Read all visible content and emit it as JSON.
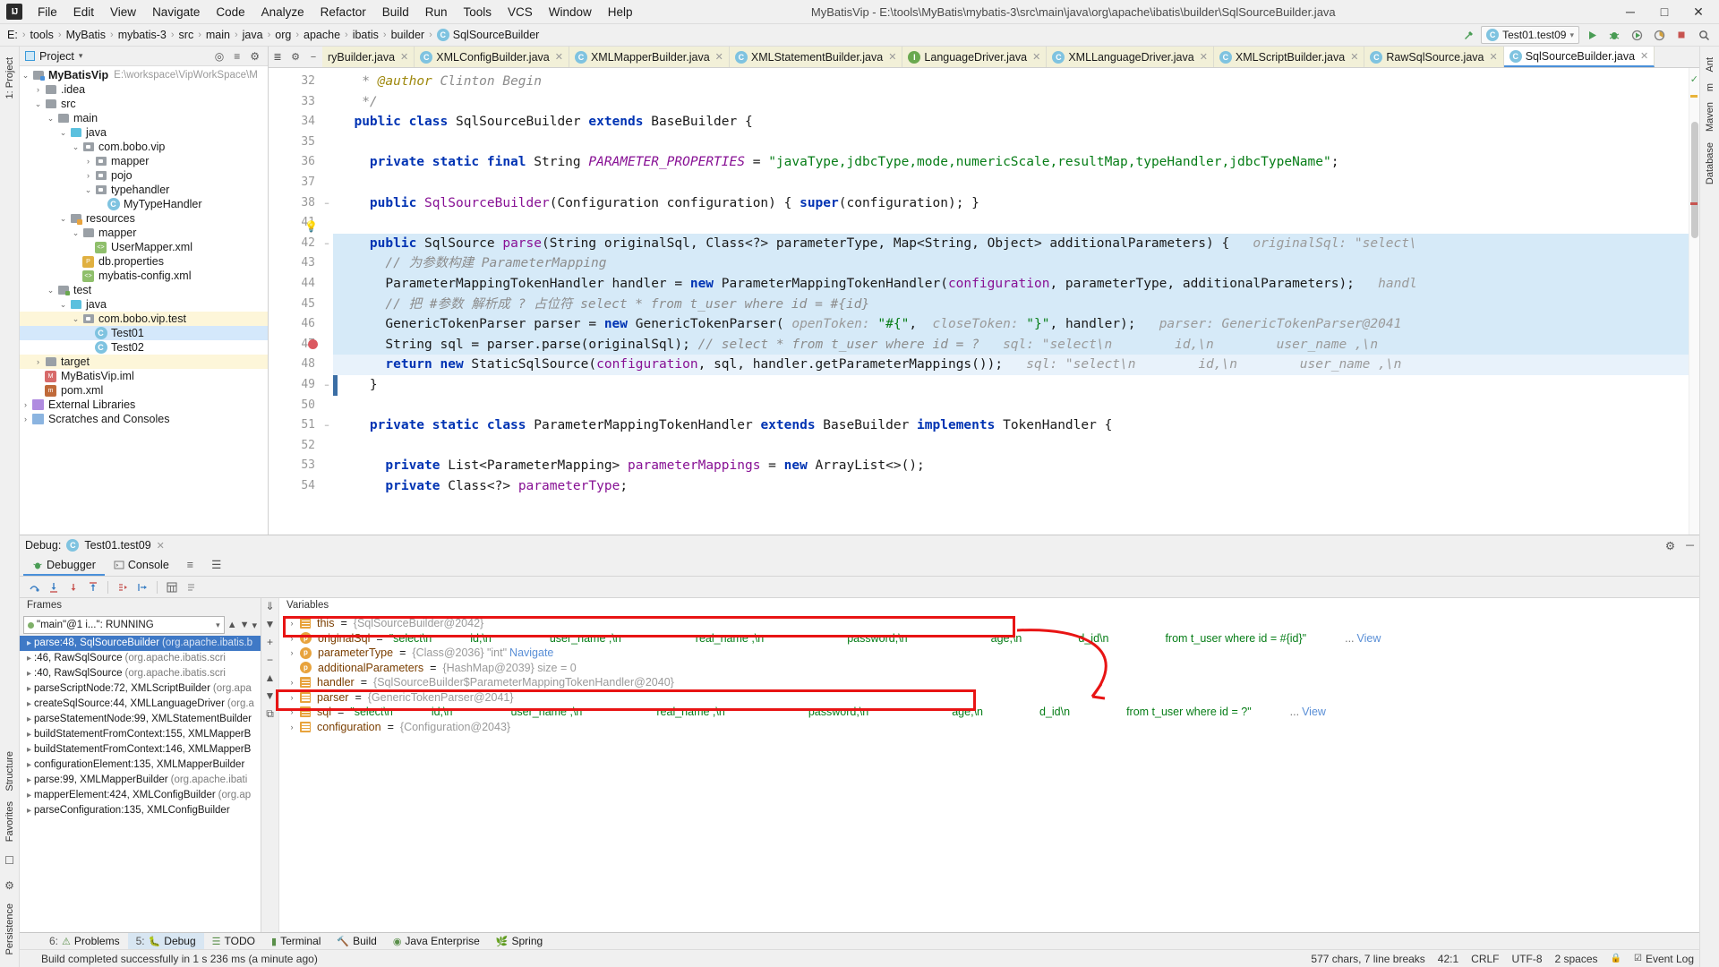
{
  "titlebar": {
    "logo": "IJ",
    "window_title": "MyBatisVip - E:\\tools\\MyBatis\\mybatis-3\\src\\main\\java\\org\\apache\\ibatis\\builder\\SqlSourceBuilder.java",
    "menus": [
      "File",
      "Edit",
      "View",
      "Navigate",
      "Code",
      "Analyze",
      "Refactor",
      "Build",
      "Run",
      "Tools",
      "VCS",
      "Window",
      "Help"
    ],
    "minimize": "─",
    "maximize": "□",
    "close": "✕"
  },
  "navbar": {
    "crumbs": [
      "E:",
      "tools",
      "MyBatis",
      "mybatis-3",
      "src",
      "main",
      "java",
      "org",
      "apache",
      "ibatis",
      "builder"
    ],
    "class_crumb": "SqlSourceBuilder",
    "class_icon": "C",
    "run_config": "Test01.test09",
    "run_config_icon": "C",
    "build_icon": "hammer-icon",
    "run_icon": "▶",
    "debug_icon": "debug-bug-icon",
    "coverage_icon": "◑",
    "profile_icon": "◷",
    "stop_icon": "■",
    "search_icon": "⌕"
  },
  "left_rail": {
    "top_tab": "1: Project",
    "bottom_tabs": [
      "Structure",
      "Favorites",
      "Persistence"
    ]
  },
  "right_rail": {
    "tabs": [
      "Ant",
      "m",
      "Maven",
      "Database"
    ]
  },
  "project": {
    "title": "Project",
    "chevron": "▾",
    "icons": [
      "locate-icon",
      "collapse-all-icon",
      "settings-gear-icon"
    ],
    "tree": [
      {
        "depth": 0,
        "arrow": "⌄",
        "icon": "folder-module",
        "label": "MyBatisVip",
        "bold": true,
        "path": "E:\\workspace\\VipWorkSpace\\M"
      },
      {
        "depth": 1,
        "arrow": "›",
        "icon": "folder",
        "label": ".idea",
        "bold": false,
        "path": ""
      },
      {
        "depth": 1,
        "arrow": "⌄",
        "icon": "folder",
        "label": "src",
        "bold": false,
        "path": ""
      },
      {
        "depth": 2,
        "arrow": "⌄",
        "icon": "folder",
        "label": "main",
        "bold": false,
        "path": ""
      },
      {
        "depth": 3,
        "arrow": "⌄",
        "icon": "folder-source",
        "label": "java",
        "bold": false,
        "path": ""
      },
      {
        "depth": 4,
        "arrow": "⌄",
        "icon": "package",
        "label": "com.bobo.vip",
        "bold": false,
        "path": ""
      },
      {
        "depth": 5,
        "arrow": "›",
        "icon": "package",
        "label": "mapper",
        "bold": false,
        "path": ""
      },
      {
        "depth": 5,
        "arrow": "›",
        "icon": "package",
        "label": "pojo",
        "bold": false,
        "path": ""
      },
      {
        "depth": 5,
        "arrow": "⌄",
        "icon": "package",
        "label": "typehandler",
        "bold": false,
        "path": ""
      },
      {
        "depth": 6,
        "arrow": "",
        "icon": "class",
        "label": "MyTypeHandler",
        "bold": false,
        "path": ""
      },
      {
        "depth": 3,
        "arrow": "⌄",
        "icon": "folder-resources",
        "label": "resources",
        "bold": false,
        "path": ""
      },
      {
        "depth": 4,
        "arrow": "⌄",
        "icon": "folder",
        "label": "mapper",
        "bold": false,
        "path": ""
      },
      {
        "depth": 5,
        "arrow": "",
        "icon": "xml",
        "label": "UserMapper.xml",
        "bold": false,
        "path": ""
      },
      {
        "depth": 4,
        "arrow": "",
        "icon": "properties",
        "label": "db.properties",
        "bold": false,
        "path": ""
      },
      {
        "depth": 4,
        "arrow": "",
        "icon": "xml",
        "label": "mybatis-config.xml",
        "bold": false,
        "path": ""
      },
      {
        "depth": 2,
        "arrow": "⌄",
        "icon": "folder-test",
        "label": "test",
        "bold": false,
        "path": ""
      },
      {
        "depth": 3,
        "arrow": "⌄",
        "icon": "folder-source",
        "label": "java",
        "bold": false,
        "path": ""
      },
      {
        "depth": 4,
        "arrow": "⌄",
        "icon": "package",
        "label": "com.bobo.vip.test",
        "bold": false,
        "path": "",
        "highlight": "a"
      },
      {
        "depth": 5,
        "arrow": "",
        "icon": "class",
        "label": "Test01",
        "bold": false,
        "path": "",
        "highlight": "b"
      },
      {
        "depth": 5,
        "arrow": "",
        "icon": "class",
        "label": "Test02",
        "bold": false,
        "path": ""
      },
      {
        "depth": 1,
        "arrow": "›",
        "icon": "folder-target",
        "label": "target",
        "bold": false,
        "path": "",
        "highlight": "a"
      },
      {
        "depth": 1,
        "arrow": "",
        "icon": "iml",
        "label": "MyBatisVip.iml",
        "bold": false,
        "path": ""
      },
      {
        "depth": 1,
        "arrow": "",
        "icon": "maven",
        "label": "pom.xml",
        "bold": false,
        "path": ""
      },
      {
        "depth": 0,
        "arrow": "›",
        "icon": "library",
        "label": "External Libraries",
        "bold": false,
        "path": ""
      },
      {
        "depth": 0,
        "arrow": "›",
        "icon": "scratch",
        "label": "Scratches and Consoles",
        "bold": false,
        "path": ""
      }
    ]
  },
  "editor": {
    "tabs": [
      {
        "label": "ryBuilder.java",
        "icon": "C",
        "active": false,
        "clipped": true
      },
      {
        "label": "XMLConfigBuilder.java",
        "icon": "C",
        "active": false
      },
      {
        "label": "XMLMapperBuilder.java",
        "icon": "C",
        "active": false
      },
      {
        "label": "XMLStatementBuilder.java",
        "icon": "C",
        "active": false
      },
      {
        "label": "LanguageDriver.java",
        "icon": "I",
        "active": false
      },
      {
        "label": "XMLLanguageDriver.java",
        "icon": "C",
        "active": false
      },
      {
        "label": "XMLScriptBuilder.java",
        "icon": "C",
        "active": false
      },
      {
        "label": "RawSqlSource.java",
        "icon": "C",
        "active": false
      },
      {
        "label": "SqlSourceBuilder.java",
        "icon": "C",
        "active": true
      }
    ],
    "tab_close": "✕",
    "first_line": 32,
    "lines": [
      {
        "n": 32,
        "fold": "",
        "html": "   <span class='cmt'>* <span class='anno'>@author</span> Clinton Begin</span>"
      },
      {
        "n": 33,
        "fold": "",
        "html": "   <span class='cmt'>*/</span>"
      },
      {
        "n": 34,
        "fold": "",
        "html": "  <span class='kw'>public class</span> SqlSourceBuilder <span class='kw'>extends</span> BaseBuilder {"
      },
      {
        "n": 35,
        "fold": "",
        "html": ""
      },
      {
        "n": 36,
        "fold": "",
        "html": "    <span class='kw'>private static final</span> String <span class='stat'>PARAMETER_PROPERTIES</span> = <span class='str'>\"javaType,jdbcType,mode,numericScale,resultMap,typeHandler,jdbcTypeName\"</span>;"
      },
      {
        "n": 37,
        "fold": "",
        "html": ""
      },
      {
        "n": 38,
        "fold": "−",
        "html": "    <span class='kw'>public</span> <span class='fld'>SqlSourceBuilder</span>(Configuration configuration) { <span class='kw'>super</span>(configuration); }"
      },
      {
        "n": 41,
        "fold": "",
        "html": ""
      },
      {
        "n": 42,
        "fold": "−",
        "html": "    <span class='kw'>public</span> SqlSource <span class='fld'>parse</span>(String originalSql, Class&lt;?&gt; parameterType, Map&lt;String, Object&gt; additionalParameters) {",
        "hint": "originalSql: \"select\\",
        "hl": true
      },
      {
        "n": 43,
        "fold": "",
        "html": "      <span class='cmt-cn'>// 为参数构建 ParameterMapping</span>",
        "hl": true
      },
      {
        "n": 44,
        "fold": "",
        "html": "      ParameterMappingTokenHandler handler = <span class='kw'>new</span> ParameterMappingTokenHandler(<span class='fld'>configuration</span>, parameterType, additionalParameters);",
        "hint": "handl",
        "hl": true
      },
      {
        "n": 45,
        "fold": "",
        "html": "      <span class='cmt-cn'>// 把 #参数 解析成 ? 占位符 select * from t_user where id = #{id}</span>",
        "hl": true
      },
      {
        "n": 46,
        "fold": "",
        "html": "      GenericTokenParser parser = <span class='kw'>new</span> GenericTokenParser( <span class='hint'>openToken:</span> <span class='str'>\"#{\"</span>,  <span class='hint'>closeToken:</span> <span class='str'>\"}\"</span>, handler);",
        "hint": "parser: GenericTokenParser@2041",
        "hl": true
      },
      {
        "n": 47,
        "fold": "",
        "html": "      String sql = parser.parse(originalSql); <span class='cmt'>// select * from t_user where id = ?</span>",
        "hint": "sql: \"select\\n        id,\\n        user_name ,\\n",
        "hl": true,
        "breakpoint": true
      },
      {
        "n": 48,
        "fold": "",
        "html": "      <span class='kw'>return new</span> StaticSqlSource(<span class='fld'>configuration</span>, sql, handler.getParameterMappings());",
        "hint": "sql: \"select\\n        id,\\n        user_name ,\\n",
        "hl": true,
        "current": true
      },
      {
        "n": 49,
        "fold": "−",
        "html": "    }"
      },
      {
        "n": 50,
        "fold": "",
        "html": ""
      },
      {
        "n": 51,
        "fold": "−",
        "html": "    <span class='kw'>private static class</span> ParameterMappingTokenHandler <span class='kw'>extends</span> BaseBuilder <span class='kw'>implements</span> TokenHandler {"
      },
      {
        "n": 52,
        "fold": "",
        "html": ""
      },
      {
        "n": 53,
        "fold": "",
        "html": "      <span class='kw'>private</span> List&lt;ParameterMapping&gt; <span class='fld'>parameterMappings</span> = <span class='kw'>new</span> ArrayList&lt;&gt;();"
      },
      {
        "n": 54,
        "fold": "",
        "html": "      <span class='kw'>private</span> Class&lt;?&gt; <span class='fld'>parameterType</span>;"
      }
    ]
  },
  "debug": {
    "label": "Debug:",
    "session": "Test01.test09",
    "session_icon": "C",
    "close": "✕",
    "settings_icon": "⚙",
    "minimize_icon": "─",
    "tabs": [
      {
        "label": "Debugger",
        "icon": "debugger-icon",
        "active": true
      },
      {
        "label": "Console",
        "icon": "console-icon",
        "active": false
      }
    ],
    "tab_icons": [
      "≡",
      "☰"
    ],
    "toolbar_icons": [
      "step-over-icon",
      "step-into-icon",
      "force-step-into-icon",
      "step-out-icon",
      "drop-frame-icon",
      "run-to-cursor-icon",
      "evaluate-icon",
      "mute-breakpoints-icon"
    ],
    "frames_title": "Frames",
    "thread": "\"main\"@1 i...\": RUNNING",
    "thread_chevron": "▾",
    "frames": [
      {
        "label": "parse:48, SqlSourceBuilder",
        "dim": "(org.apache.ibatis.b",
        "selected": true
      },
      {
        "label": "<init>:46, RawSqlSource",
        "dim": "(org.apache.ibatis.scri",
        "selected": false
      },
      {
        "label": "<init>:40, RawSqlSource",
        "dim": "(org.apache.ibatis.scri",
        "selected": false
      },
      {
        "label": "parseScriptNode:72, XMLScriptBuilder",
        "dim": "(org.apa",
        "selected": false
      },
      {
        "label": "createSqlSource:44, XMLLanguageDriver",
        "dim": "(org.a",
        "selected": false
      },
      {
        "label": "parseStatementNode:99, XMLStatementBuilder",
        "dim": "",
        "selected": false
      },
      {
        "label": "buildStatementFromContext:155, XMLMapperB",
        "dim": "",
        "selected": false
      },
      {
        "label": "buildStatementFromContext:146, XMLMapperB",
        "dim": "",
        "selected": false
      },
      {
        "label": "configurationElement:135, XMLMapperBuilder",
        "dim": "",
        "selected": false
      },
      {
        "label": "parse:99, XMLMapperBuilder",
        "dim": "(org.apache.ibati",
        "selected": false
      },
      {
        "label": "mapperElement:424, XMLConfigBuilder",
        "dim": "(org.ap",
        "selected": false
      },
      {
        "label": "parseConfiguration:135, XMLConfigBuilder",
        "dim": "",
        "selected": false
      }
    ],
    "vars_title": "Variables",
    "vars": [
      {
        "arrow": "›",
        "badge": "list",
        "name": "this",
        "eq": "=",
        "value": "{SqlSourceBuilder@2042}",
        "vtype": "obj"
      },
      {
        "arrow": "›",
        "badge": "p",
        "name": "originalSql",
        "eq": "=",
        "value": "\"select\\n        id,\\n        user_name ,\\n        real_name ,\\n        password,\\n        age,\\n        d_id\\n        from t_user where id = #{id}\"",
        "vtype": "str",
        "more": "...",
        "link": "View",
        "boxed": true
      },
      {
        "arrow": "›",
        "badge": "p",
        "name": "parameterType",
        "eq": "=",
        "value": "{Class@2036} \"int\"",
        "vtype": "obj",
        "link": "Navigate"
      },
      {
        "arrow": "",
        "badge": "p",
        "name": "additionalParameters",
        "eq": "=",
        "value": "{HashMap@2039}  size = 0",
        "vtype": "obj"
      },
      {
        "arrow": "›",
        "badge": "list",
        "name": "handler",
        "eq": "=",
        "value": "{SqlSourceBuilder$ParameterMappingTokenHandler@2040}",
        "vtype": "obj"
      },
      {
        "arrow": "›",
        "badge": "list",
        "name": "parser",
        "eq": "=",
        "value": "{GenericTokenParser@2041}",
        "vtype": "obj"
      },
      {
        "arrow": "›",
        "badge": "list",
        "name": "sql",
        "eq": "=",
        "value": "\"select\\n        id,\\n        user_name ,\\n        real_name ,\\n        password,\\n        age,\\n        d_id\\n        from t_user where id = ?\"",
        "vtype": "str",
        "more": "...",
        "link": "View",
        "boxed": true
      },
      {
        "arrow": "›",
        "badge": "list",
        "name": "configuration",
        "eq": "=",
        "value": "{Configuration@2043}",
        "vtype": "obj"
      }
    ],
    "originalsql_segments": [
      "\"select\\n",
      "id,\\n",
      "user_name ,\\n",
      "real_name ,\\n",
      "password,\\n",
      "age,\\n",
      "d_id\\n",
      "from t_user where id = #{id}\""
    ],
    "sql_segments": [
      "\"select\\n",
      "id,\\n",
      "user_name ,\\n",
      "real_name ,\\n",
      "password,\\n",
      "age,\\n",
      "d_id\\n",
      "from t_user where id = ?\""
    ]
  },
  "bottom_tabs": [
    {
      "num": "6:",
      "label": "Problems",
      "icon": "problems-icon",
      "active": false
    },
    {
      "num": "5:",
      "label": "Debug",
      "icon": "debug-icon",
      "active": true
    },
    {
      "num": "",
      "label": "TODO",
      "icon": "todo-icon",
      "active": false
    },
    {
      "num": "",
      "label": "Terminal",
      "icon": "terminal-icon",
      "active": false
    },
    {
      "num": "",
      "label": "Build",
      "icon": "build-icon",
      "active": false
    },
    {
      "num": "",
      "label": "Java Enterprise",
      "icon": "java-ee-icon",
      "active": false
    },
    {
      "num": "",
      "label": "Spring",
      "icon": "spring-icon",
      "active": false
    }
  ],
  "statusbar": {
    "message": "Build completed successfully in 1 s 236 ms (a minute ago)",
    "chars_info": "577 chars, 7 line breaks",
    "caret": "42:1",
    "line_sep": "CRLF",
    "encoding": "UTF-8",
    "indent": "2 spaces",
    "lock_icon": "🔒",
    "event_log": "Event Log",
    "event_log_icon": "☑"
  }
}
